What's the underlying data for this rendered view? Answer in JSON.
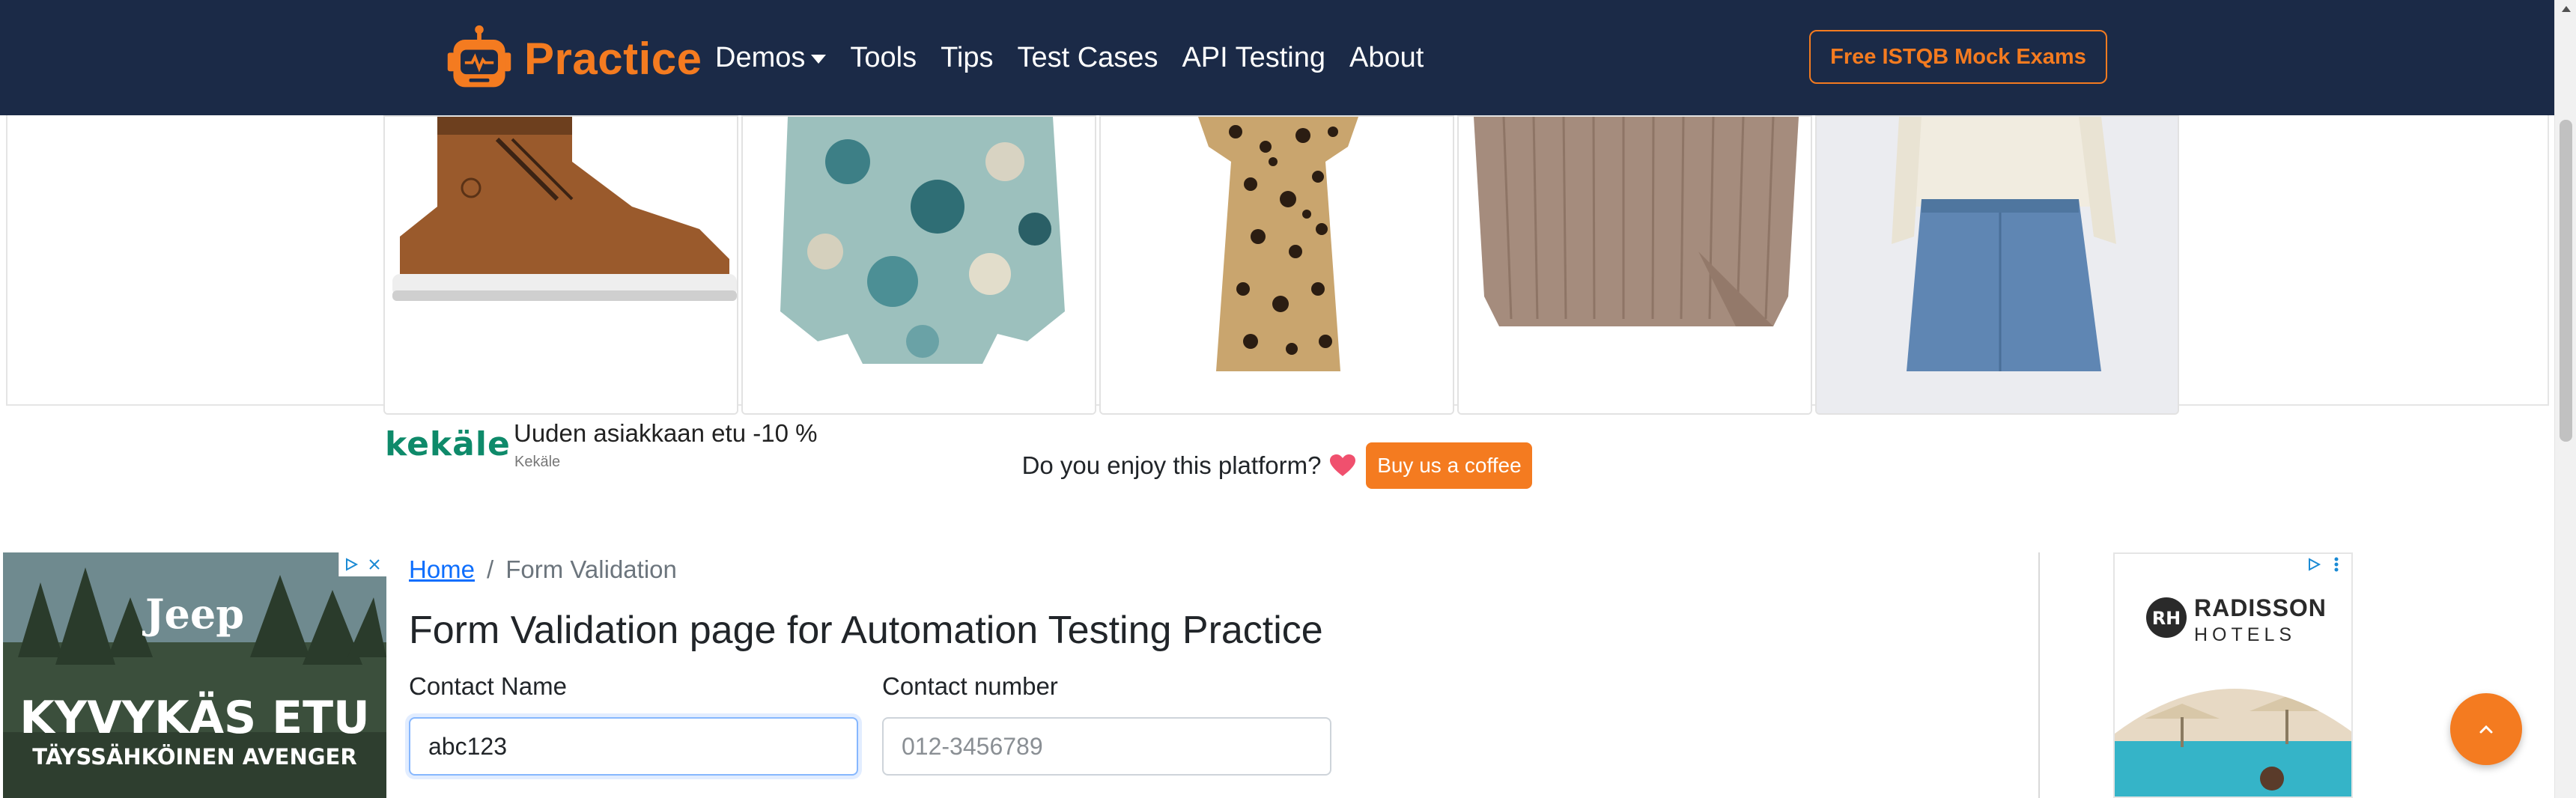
{
  "nav": {
    "brand": "Practice",
    "links": [
      "Demos",
      "Tools",
      "Tips",
      "Test Cases",
      "API Testing",
      "About"
    ],
    "cta": "Free ISTQB Mock Exams"
  },
  "top_ad": {
    "advertiser_logo": "kekäle",
    "headline": "Uuden asiakkaan etu -10 %",
    "advertiser": "Kekäle",
    "products": [
      "brown leather boot",
      "floral blouse",
      "leopard print dress",
      "knit sweater",
      "denim skirt with cream sweater"
    ]
  },
  "support": {
    "text": "Do you enjoy this platform?",
    "button": "Buy us a coffee"
  },
  "left_ad": {
    "logo": "Jeep",
    "headline": "KYVYKÄS ETU",
    "sub": "TÄYSSÄHKÖINEN AVENGER"
  },
  "breadcrumb": {
    "home": "Home",
    "separator": "/",
    "current": "Form Validation"
  },
  "page": {
    "title": "Form Validation page for Automation Testing Practice"
  },
  "form": {
    "contact_name": {
      "label": "Contact Name",
      "value": "abc123"
    },
    "contact_number": {
      "label": "Contact number",
      "placeholder": "012-3456789"
    }
  },
  "right_ad": {
    "brand": "RADISSON",
    "sub": "HOTELS"
  },
  "colors": {
    "nav_bg": "#1b2a47",
    "accent": "#f47b20",
    "link": "#0d6efd"
  }
}
